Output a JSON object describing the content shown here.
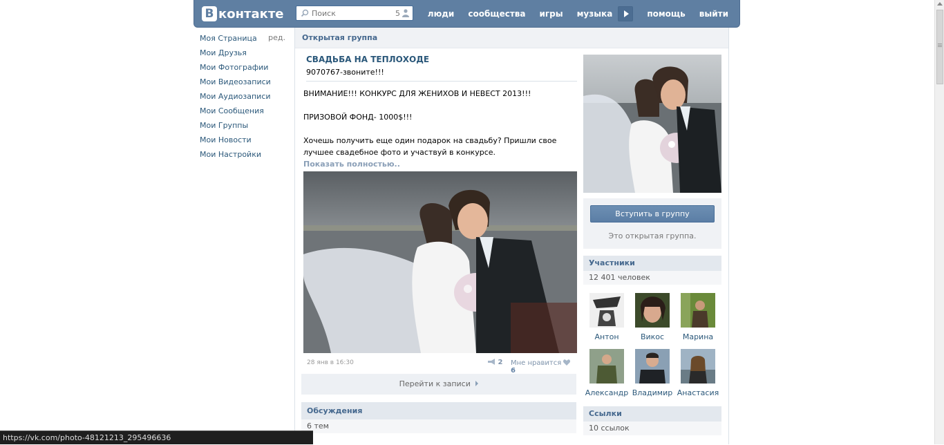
{
  "header": {
    "logo_letter": "В",
    "logo_text": "контакте",
    "search_placeholder": "Поиск",
    "search_count": "5",
    "nav": [
      "люди",
      "сообщества",
      "игры",
      "музыка",
      "помощь",
      "выйти"
    ]
  },
  "sidebar": {
    "edit_label": "ред.",
    "items": [
      {
        "label": "Моя Страница"
      },
      {
        "label": "Мои Друзья"
      },
      {
        "label": "Мои Фотографии"
      },
      {
        "label": "Мои Видеозаписи"
      },
      {
        "label": "Мои Аудиозаписи"
      },
      {
        "label": "Мои Сообщения"
      },
      {
        "label": "Мои Группы"
      },
      {
        "label": "Мои Новости"
      },
      {
        "label": "Мои Настройки"
      }
    ]
  },
  "page": {
    "section_title": "Открытая группа"
  },
  "group": {
    "name": "СВАДЬБА НА ТЕПЛОХОДЕ",
    "status": "9070767-звоните!!!"
  },
  "post": {
    "line1": "ВНИМАНИЕ!!! КОНКУРС ДЛЯ ЖЕНИХОВ И НЕВЕСТ 2013!!!",
    "line2": "ПРИЗОВОЙ ФОНД- 1000$!!!",
    "line3": "Хочешь получить еще один подарок на свадьбу? Пришли свое лучшее свадебное фото и участвуй в конкурсе.",
    "show_more": "Показать полностью..",
    "date": "28 янв в 16:30",
    "shares": "2",
    "likes_label": "Мне нравится",
    "likes_count": "6",
    "goto_label": "Перейти к записи"
  },
  "discussions": {
    "title": "Обсуждения",
    "count": "6 тем"
  },
  "right": {
    "join_button": "Вступить в группу",
    "open_note": "Это открытая группа.",
    "members_title": "Участники",
    "members_count": "12 401 человек",
    "members": [
      {
        "name": "Антон"
      },
      {
        "name": "Викос"
      },
      {
        "name": "Марина"
      },
      {
        "name": "Александр"
      },
      {
        "name": "Владимир"
      },
      {
        "name": "Анастасия"
      }
    ],
    "links_title": "Ссылки",
    "links_count": "10 ссылок"
  },
  "statusbar": {
    "url": "https://vk.com/photo-48121213_295496636"
  },
  "colors": {
    "brand": "#5f7fa2",
    "link": "#2b587a",
    "box_header": "#e3e8ee"
  }
}
